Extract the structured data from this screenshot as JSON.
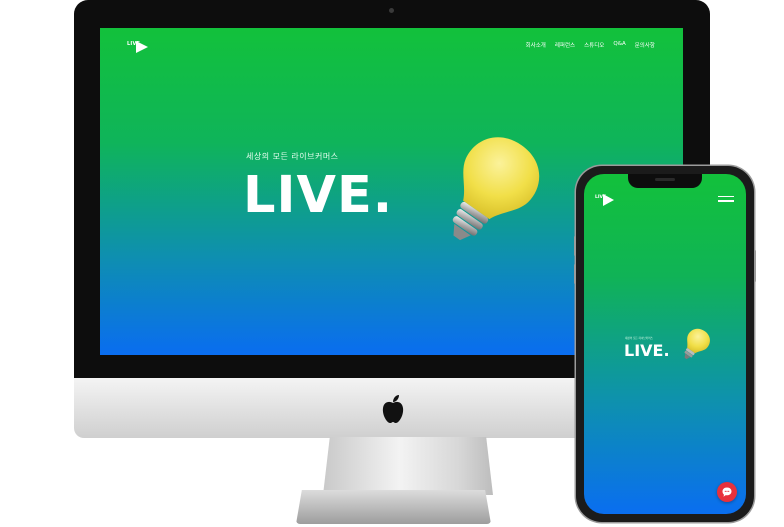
{
  "desktop": {
    "logo_text": "LIVE",
    "nav": [
      "회사소개",
      "레퍼런스",
      "스튜디오",
      "Q&A",
      "문의사항"
    ],
    "hero_subtitle": "세상의 모든 라이브커머스",
    "hero_title": "LIVE."
  },
  "mobile": {
    "logo_text": "LIVE",
    "hero_subtitle": "세상의 모든 라이브커머스",
    "hero_title": "LIVE."
  },
  "colors": {
    "gradient_top": "#12c13b",
    "gradient_bottom": "#0a6df0",
    "chat_button": "#e8313c",
    "bulb": "#f4e55a"
  },
  "icons": [
    "play-logo-icon",
    "apple-logo-icon",
    "lightbulb-icon",
    "hamburger-menu-icon",
    "chat-bubble-icon"
  ]
}
